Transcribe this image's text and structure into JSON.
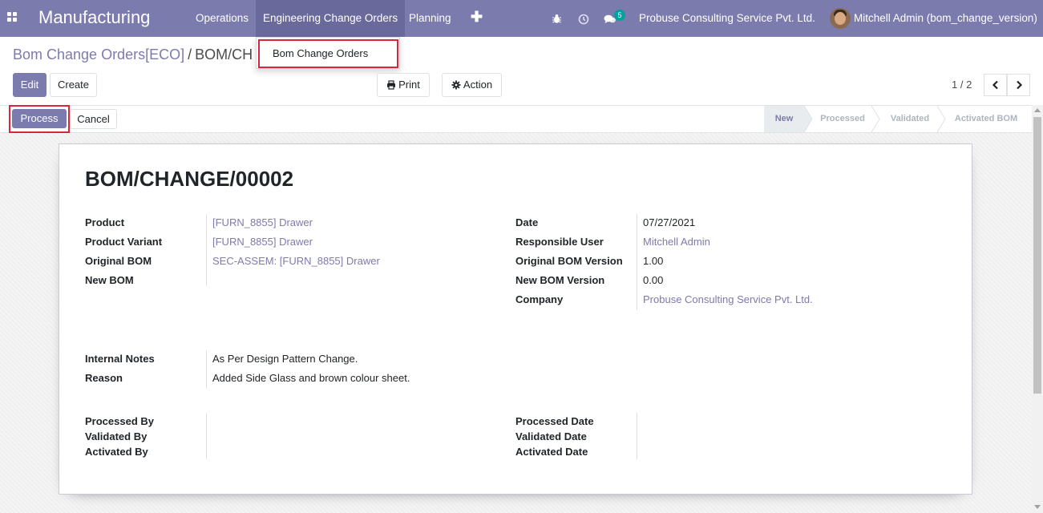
{
  "navbar": {
    "brand": "Manufacturing",
    "menus": [
      "Operations",
      "Engineering Change Orders",
      "Planning"
    ],
    "messages_count": "5",
    "company": "Probuse Consulting Service Pvt. Ltd.",
    "user": "Mitchell Admin (bom_change_version)"
  },
  "dropdown": {
    "items": [
      "Bom Change Orders"
    ]
  },
  "breadcrumb": {
    "parent": "Bom Change Orders[ECO]",
    "separator": "/",
    "current": "BOM/CH"
  },
  "toolbar": {
    "edit": "Edit",
    "create": "Create",
    "print": "Print",
    "action": "Action"
  },
  "pager": {
    "value": "1 / 2"
  },
  "statusbar": {
    "process": "Process",
    "cancel": "Cancel",
    "stages": [
      "New",
      "Processed",
      "Validated",
      "Activated BOM"
    ],
    "active_stage": "New"
  },
  "record": {
    "title": "BOM/CHANGE/00002",
    "left_fields": [
      {
        "label": "Product",
        "value": "[FURN_8855] Drawer"
      },
      {
        "label": "Product Variant",
        "value": "[FURN_8855] Drawer"
      },
      {
        "label": "Original BOM",
        "value": "SEC-ASSEM: [FURN_8855] Drawer"
      },
      {
        "label": "New BOM",
        "value": ""
      }
    ],
    "right_fields": [
      {
        "label": "Date",
        "value": "07/27/2021"
      },
      {
        "label": "Responsible User",
        "value": "Mitchell Admin"
      },
      {
        "label": "Original BOM Version",
        "value": "1.00"
      },
      {
        "label": "New BOM Version",
        "value": "0.00"
      },
      {
        "label": "Company",
        "value": "Probuse Consulting Service Pvt. Ltd."
      }
    ],
    "notes": [
      {
        "label": "Internal Notes",
        "value": "As Per Design Pattern Change."
      },
      {
        "label": "Reason",
        "value": "Added Side Glass and brown colour sheet."
      }
    ],
    "left_bottom": [
      "Processed By",
      "Validated By",
      "Activated By"
    ],
    "right_bottom": [
      "Processed Date",
      "Validated Date",
      "Activated Date"
    ]
  },
  "colors": {
    "brand": "#7c7bad",
    "highlight_border": "#d7263d",
    "badge": "#00a09d"
  }
}
